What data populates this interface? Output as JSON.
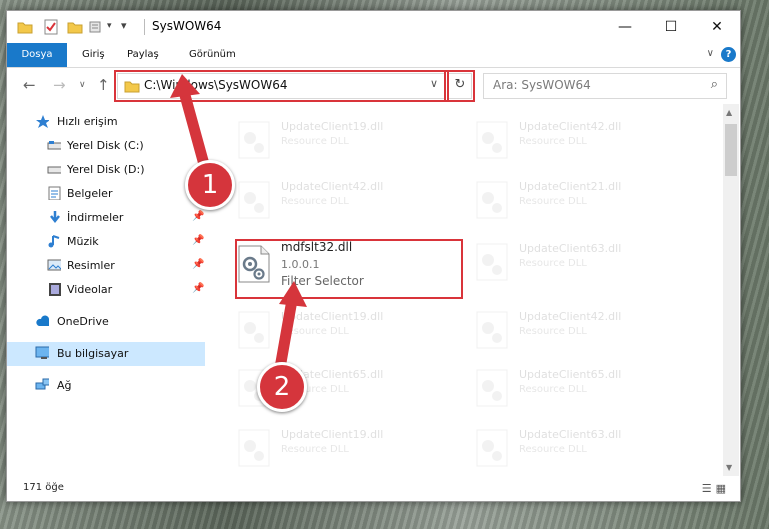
{
  "window": {
    "title": "SysWOW64",
    "controls": {
      "minimize": "—",
      "maximize": "☐",
      "close": "✕"
    }
  },
  "ribbon": {
    "tabs": [
      {
        "label": "Dosya"
      },
      {
        "label": "Giriş"
      },
      {
        "label": "Paylaş"
      },
      {
        "label": "Görünüm"
      }
    ],
    "help_label": "?"
  },
  "address": {
    "path": "C:\\Windows\\SysWOW64"
  },
  "search": {
    "placeholder": "Ara: SysWOW64"
  },
  "sidebar": {
    "items": [
      {
        "label": "Hızlı erişim",
        "icon": "star-icon"
      },
      {
        "label": "Yerel Disk (C:)",
        "icon": "drive-icon"
      },
      {
        "label": "Yerel Disk (D:)",
        "icon": "drive-icon"
      },
      {
        "label": "Belgeler",
        "icon": "documents-icon",
        "pinned": true
      },
      {
        "label": "İndirmeler",
        "icon": "download-icon",
        "pinned": true
      },
      {
        "label": "Müzik",
        "icon": "music-icon",
        "pinned": true
      },
      {
        "label": "Resimler",
        "icon": "pictures-icon",
        "pinned": true
      },
      {
        "label": "Videolar",
        "icon": "videos-icon",
        "pinned": true
      },
      {
        "label": "OneDrive",
        "icon": "cloud-icon"
      },
      {
        "label": "Bu bilgisayar",
        "icon": "computer-icon",
        "selected": true
      },
      {
        "label": "Ağ",
        "icon": "network-icon"
      }
    ]
  },
  "files": {
    "left": [
      {
        "name": "UpdateClient19.dll",
        "desc": "Resource DLL"
      },
      {
        "name": "UpdateClient42.dll",
        "desc": "Resource DLL"
      },
      {
        "name": "mdfslt32.dll",
        "version": "1.0.0.1",
        "desc": "Filter Selector"
      },
      {
        "name": "UpdateClient19.dll",
        "desc": "Resource DLL"
      },
      {
        "name": "UpdateClient65.dll",
        "desc": "Resource DLL"
      },
      {
        "name": "UpdateClient19.dll",
        "desc": "Resource DLL"
      }
    ],
    "right": [
      {
        "name": "UpdateClient42.dll",
        "desc": "Resource DLL"
      },
      {
        "name": "UpdateClient21.dll",
        "desc": "Resource DLL"
      },
      {
        "name": "UpdateClient63.dll",
        "desc": "Resource DLL"
      },
      {
        "name": "UpdateClient42.dll",
        "desc": "Resource DLL"
      },
      {
        "name": "UpdateClient65.dll",
        "desc": "Resource DLL"
      },
      {
        "name": "UpdateClient63.dll",
        "desc": "Resource DLL"
      }
    ]
  },
  "status": {
    "count": "171 öğe"
  },
  "callouts": {
    "one": "1",
    "two": "2"
  },
  "colors": {
    "accent": "#1979ca",
    "highlight": "#d9343a",
    "selected": "#cce8ff"
  }
}
